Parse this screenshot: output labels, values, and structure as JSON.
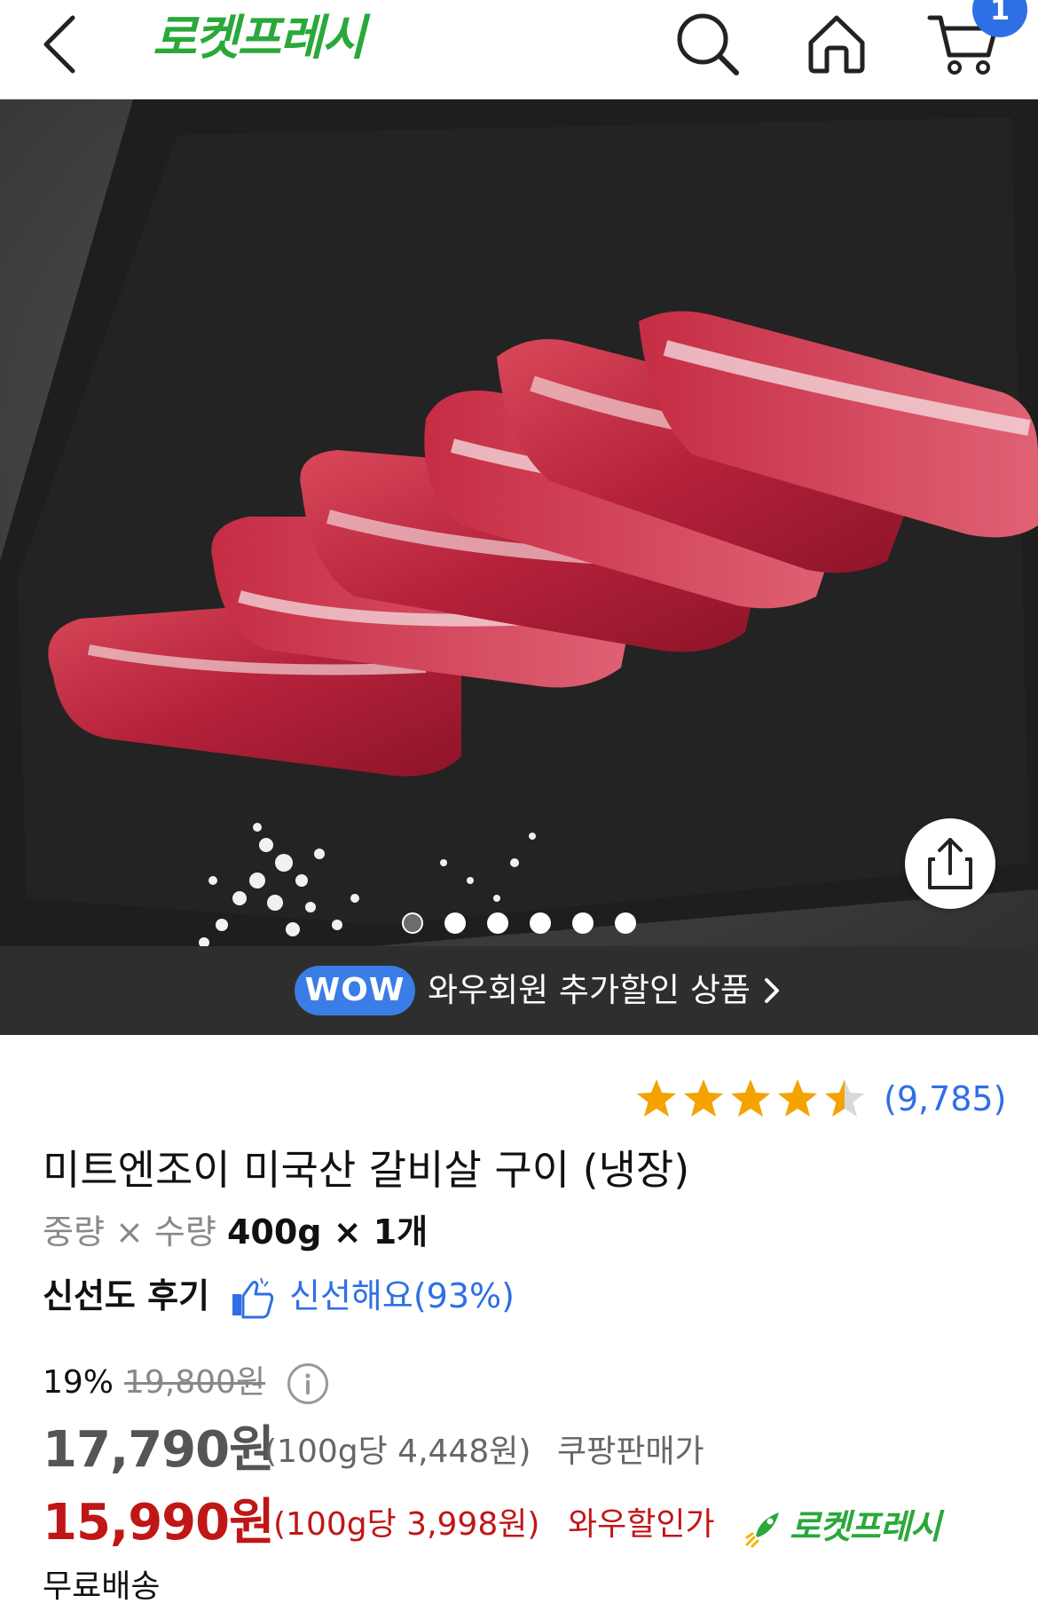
{
  "header": {
    "brand": "로켓프레시",
    "cart_count": "1",
    "icons": [
      "back-icon",
      "search-icon",
      "home-icon",
      "cart-icon"
    ]
  },
  "hero": {
    "slide_count": 6,
    "active_slide": 1,
    "icons": [
      "share-icon"
    ]
  },
  "wow_banner": {
    "pill": "WOW",
    "text": "와우회원 추가할인 상품"
  },
  "product": {
    "rating": 4.5,
    "review_count": "(9,785)",
    "title": "미트엔조이 미국산 갈비살 구이 (냉장)",
    "weight_label": "중량 × 수량",
    "weight_value": "400g × 1개",
    "freshness_label": "신선도 후기",
    "freshness_value": "신선해요(93%)",
    "discount_percent": "19%",
    "original_price": "19,800원",
    "coupang_price": "17,790원",
    "coupang_unit": "(100g당 4,448원)",
    "coupang_tag": "쿠팡판매가",
    "wow_price": "15,990원",
    "wow_unit": "(100g당 3,998원)",
    "wow_tag": "와우할인가",
    "rocket_badge": "로켓프레시",
    "shipping": "무료배송"
  },
  "colors": {
    "brand_green": "#2aa83a",
    "accent_blue": "#2f6fe6",
    "price_red": "#c01616",
    "star_gold": "#f5a300"
  }
}
